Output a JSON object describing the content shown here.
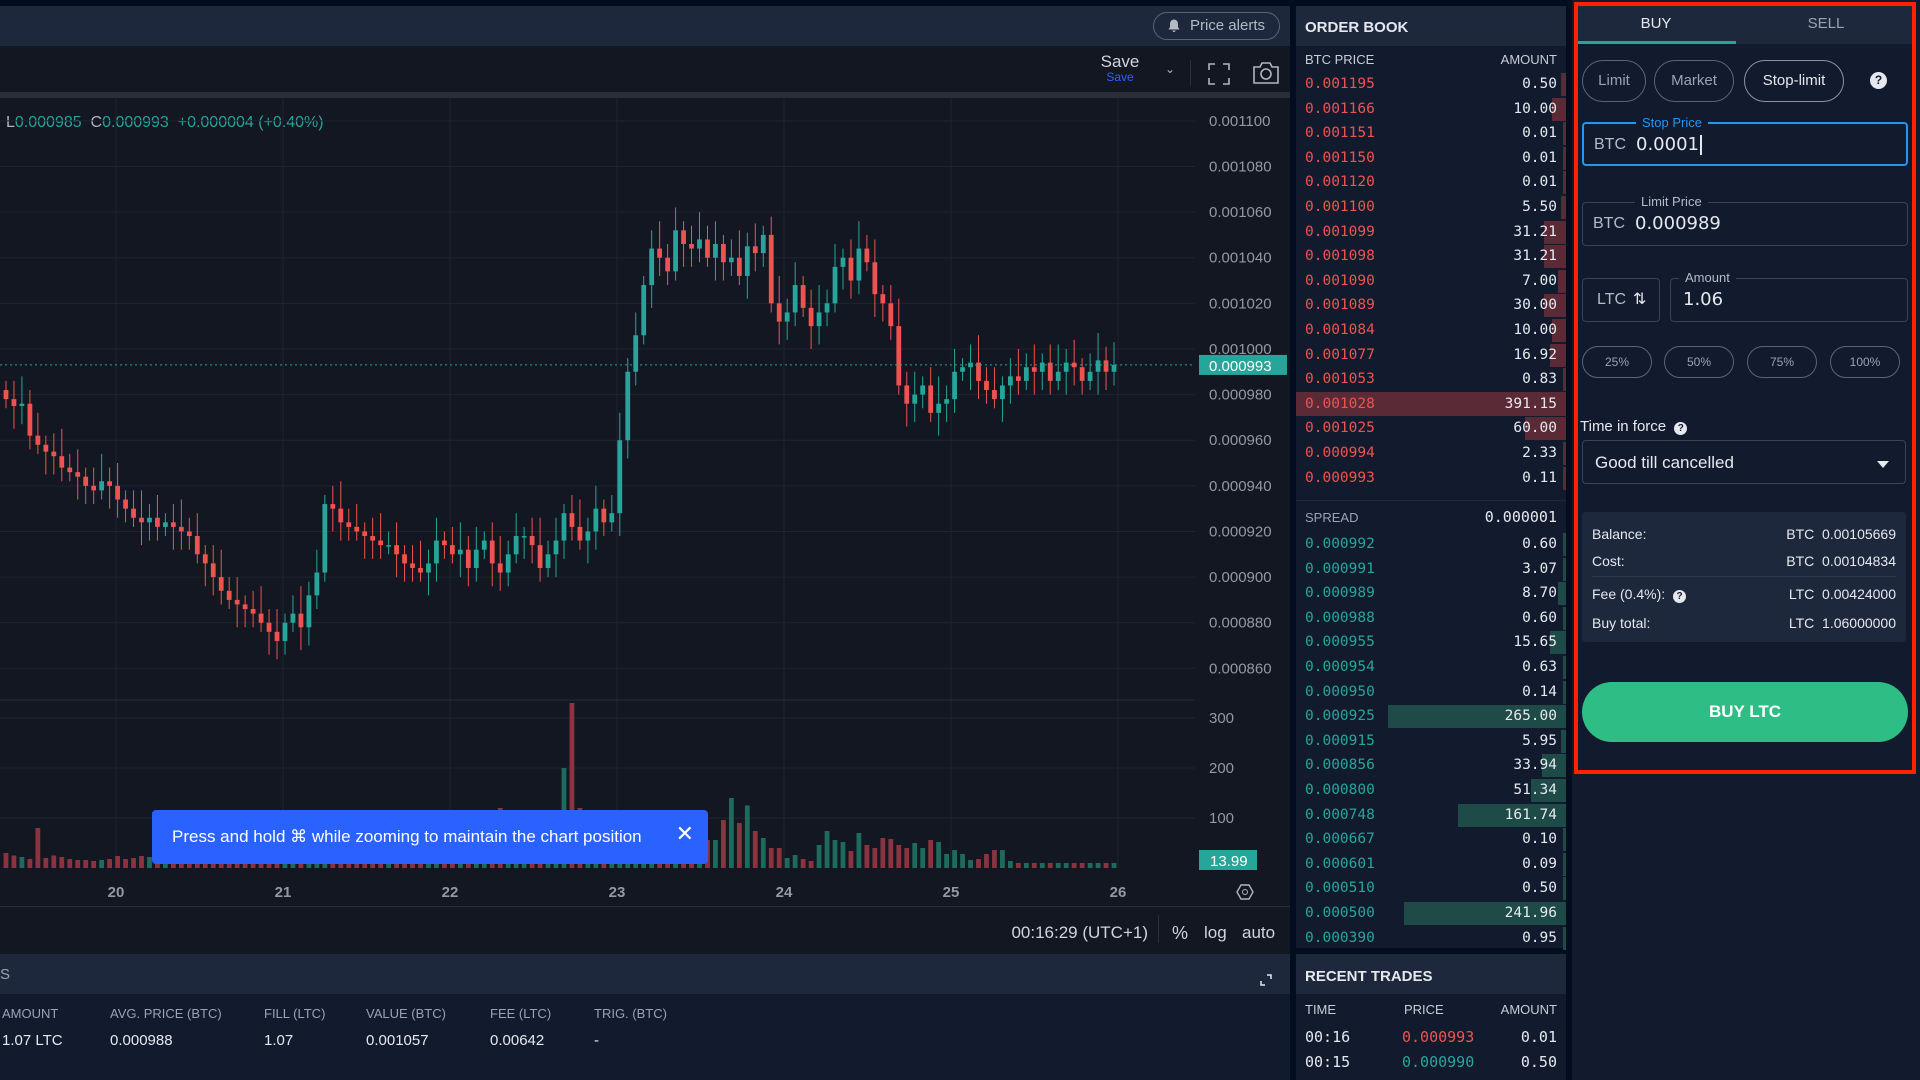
{
  "chart_header": {
    "price_alerts_label": "Price alerts",
    "save_label": "Save",
    "save_sublabel": "Save",
    "ohlc": {
      "low_label": "L",
      "low": "0.000985",
      "close_label": "C",
      "close": "0.000993",
      "change": "+0.000004 (+0.40%)"
    }
  },
  "chart_footer": {
    "clock": "00:16:29 (UTC+1)",
    "percent_label": "%",
    "log_label": "log",
    "auto_label": "auto"
  },
  "toast": {
    "message": "Press and hold ⌘ while zooming to maintain the chart position",
    "close_icon": "close-icon"
  },
  "chart_data": {
    "type": "candlestick",
    "title": "",
    "price_axis": {
      "ticks": [
        "0.001100",
        "0.001080",
        "0.001060",
        "0.001040",
        "0.001020",
        "0.001000",
        "0.000980",
        "0.000960",
        "0.000940",
        "0.000920",
        "0.000900",
        "0.000880",
        "0.000860"
      ],
      "range": [
        0.000847,
        0.00111
      ]
    },
    "last_price_label": "0.000993",
    "last_price": 0.000993,
    "volume_axis": {
      "ticks": [
        "300",
        "200",
        "100"
      ],
      "range": [
        0,
        320
      ]
    },
    "last_volume_label": "13.99",
    "date_ticks": [
      "20",
      "21",
      "22",
      "23",
      "24",
      "25",
      "26"
    ],
    "colors": {
      "up": "#26a69a",
      "down": "#ef5350"
    },
    "closes": [
      0.000978,
      0.000975,
      0.000976,
      0.000962,
      0.000958,
      0.000955,
      0.000953,
      0.000948,
      0.000946,
      0.000944,
      0.00094,
      0.000938,
      0.000942,
      0.00094,
      0.000934,
      0.00093,
      0.000926,
      0.000924,
      0.000926,
      0.000922,
      0.000924,
      0.000922,
      0.00092,
      0.000918,
      0.00091,
      0.000906,
      0.0009,
      0.000894,
      0.00089,
      0.000888,
      0.000886,
      0.000884,
      0.00088,
      0.000876,
      0.000872,
      0.00088,
      0.000884,
      0.000878,
      0.000892,
      0.000902,
      0.000932,
      0.00093,
      0.000924,
      0.000922,
      0.00092,
      0.000918,
      0.000916,
      0.000914,
      0.000914,
      0.00091,
      0.000906,
      0.000904,
      0.000902,
      0.000906,
      0.000916,
      0.000914,
      0.00091,
      0.000912,
      0.000904,
      0.000912,
      0.000916,
      0.000906,
      0.000902,
      0.00091,
      0.000918,
      0.000918,
      0.000914,
      0.000904,
      0.00091,
      0.000916,
      0.000928,
      0.000922,
      0.000916,
      0.00092,
      0.00093,
      0.000924,
      0.000928,
      0.00096,
      0.00099,
      0.001006,
      0.001028,
      0.001044,
      0.00104,
      0.001034,
      0.001052,
      0.001046,
      0.001044,
      0.001048,
      0.00104,
      0.001046,
      0.001038,
      0.00104,
      0.001032,
      0.001045,
      0.001042,
      0.00105,
      0.00102,
      0.001012,
      0.001016,
      0.001028,
      0.001018,
      0.00101,
      0.001016,
      0.00102,
      0.001036,
      0.00104,
      0.00103,
      0.001044,
      0.001038,
      0.001024,
      0.00102,
      0.00101,
      0.000984,
      0.000976,
      0.00098,
      0.000984,
      0.000972,
      0.000976,
      0.000978,
      0.00099,
      0.000992,
      0.000994,
      0.000986,
      0.000982,
      0.000978,
      0.000984,
      0.000988,
      0.000986,
      0.000992,
      0.00099,
      0.000994,
      0.000986,
      0.00099,
      0.000994,
      0.000992,
      0.000986,
      0.00099,
      0.000995,
      0.00099,
      0.000993
    ],
    "volumes": [
      30,
      25,
      22,
      18,
      80,
      20,
      25,
      22,
      18,
      16,
      16,
      14,
      16,
      18,
      24,
      18,
      20,
      24,
      22,
      35,
      30,
      25,
      40,
      22,
      30,
      26,
      30,
      38,
      28,
      50,
      30,
      28,
      24,
      20,
      22,
      26,
      24,
      28,
      22,
      20,
      26,
      24,
      20,
      22,
      30,
      24,
      28,
      26,
      22,
      22,
      24,
      28,
      30,
      22,
      26,
      30,
      24,
      22,
      20,
      26,
      50,
      55,
      120,
      60,
      58,
      100,
      60,
      40,
      36,
      100,
      200,
      330,
      120,
      60,
      70,
      90,
      50,
      40,
      36,
      90,
      36,
      80,
      56,
      60,
      62,
      40,
      32,
      34,
      56,
      56,
      96,
      140,
      90,
      125,
      74,
      60,
      40,
      40,
      20,
      26,
      18,
      14,
      46,
      74,
      56,
      52,
      34,
      70,
      46,
      40,
      60,
      58,
      46,
      40,
      50,
      40,
      56,
      52,
      28,
      36,
      28,
      16,
      18,
      28,
      36,
      36,
      14
    ]
  },
  "orders_panel": {
    "title": "S",
    "columns": [
      "AMOUNT",
      "AVG. PRICE (BTC)",
      "FILL (LTC)",
      "VALUE (BTC)",
      "FEE (LTC)",
      "TRIG. (BTC)"
    ],
    "rows": [
      [
        "1.07 LTC",
        "0.000988",
        "1.07",
        "0.001057",
        "0.00642",
        "-"
      ]
    ]
  },
  "orderbook": {
    "title": "ORDER BOOK",
    "price_header": "BTC PRICE",
    "amount_header": "AMOUNT",
    "asks": [
      {
        "price": "0.001195",
        "amount": "0.50",
        "depth": 0.02
      },
      {
        "price": "0.001166",
        "amount": "10.00",
        "depth": 0.05
      },
      {
        "price": "0.001151",
        "amount": "0.01",
        "depth": 0.01
      },
      {
        "price": "0.001150",
        "amount": "0.01",
        "depth": 0.01
      },
      {
        "price": "0.001120",
        "amount": "0.01",
        "depth": 0.01
      },
      {
        "price": "0.001100",
        "amount": "5.50",
        "depth": 0.02
      },
      {
        "price": "0.001099",
        "amount": "31.21",
        "depth": 0.08
      },
      {
        "price": "0.001098",
        "amount": "31.21",
        "depth": 0.08
      },
      {
        "price": "0.001090",
        "amount": "7.00",
        "depth": 0.03
      },
      {
        "price": "0.001089",
        "amount": "30.00",
        "depth": 0.08
      },
      {
        "price": "0.001084",
        "amount": "10.00",
        "depth": 0.05
      },
      {
        "price": "0.001077",
        "amount": "16.92",
        "depth": 0.06
      },
      {
        "price": "0.001053",
        "amount": "0.83",
        "depth": 0.01
      },
      {
        "price": "0.001028",
        "amount": "391.15",
        "depth": 1.0
      },
      {
        "price": "0.001025",
        "amount": "60.00",
        "depth": 0.15
      },
      {
        "price": "0.000994",
        "amount": "2.33",
        "depth": 0.01
      },
      {
        "price": "0.000993",
        "amount": "0.11",
        "depth": 0.01
      }
    ],
    "spread_label": "SPREAD",
    "spread_value": "0.000001",
    "bids": [
      {
        "price": "0.000992",
        "amount": "0.60",
        "depth": 0.01
      },
      {
        "price": "0.000991",
        "amount": "3.07",
        "depth": 0.01
      },
      {
        "price": "0.000989",
        "amount": "8.70",
        "depth": 0.03
      },
      {
        "price": "0.000988",
        "amount": "0.60",
        "depth": 0.01
      },
      {
        "price": "0.000955",
        "amount": "15.65",
        "depth": 0.06
      },
      {
        "price": "0.000954",
        "amount": "0.63",
        "depth": 0.01
      },
      {
        "price": "0.000950",
        "amount": "0.14",
        "depth": 0.01
      },
      {
        "price": "0.000925",
        "amount": "265.00",
        "depth": 0.66
      },
      {
        "price": "0.000915",
        "amount": "5.95",
        "depth": 0.02
      },
      {
        "price": "0.000856",
        "amount": "33.94",
        "depth": 0.09
      },
      {
        "price": "0.000800",
        "amount": "51.34",
        "depth": 0.13
      },
      {
        "price": "0.000748",
        "amount": "161.74",
        "depth": 0.4
      },
      {
        "price": "0.000667",
        "amount": "0.10",
        "depth": 0.01
      },
      {
        "price": "0.000601",
        "amount": "0.09",
        "depth": 0.01
      },
      {
        "price": "0.000510",
        "amount": "0.50",
        "depth": 0.01
      },
      {
        "price": "0.000500",
        "amount": "241.96",
        "depth": 0.6
      },
      {
        "price": "0.000390",
        "amount": "0.95",
        "depth": 0.01
      }
    ]
  },
  "recent_trades": {
    "title": "RECENT TRADES",
    "headers": [
      "TIME",
      "PRICE",
      "AMOUNT"
    ],
    "rows": [
      {
        "time": "00:16",
        "price": "0.000993",
        "amount": "0.01",
        "side": "sell"
      },
      {
        "time": "00:15",
        "price": "0.000990",
        "amount": "0.50",
        "side": "buy"
      }
    ]
  },
  "trade_form": {
    "tabs": [
      {
        "label": "BUY",
        "active": true
      },
      {
        "label": "SELL",
        "active": false
      }
    ],
    "order_types": [
      {
        "label": "Limit",
        "active": false
      },
      {
        "label": "Market",
        "active": false
      },
      {
        "label": "Stop-limit",
        "active": true
      }
    ],
    "help_glyph": "?",
    "stop_price": {
      "legend": "Stop Price",
      "currency": "BTC",
      "value": "0.0001"
    },
    "limit_price": {
      "legend": "Limit Price",
      "currency": "BTC",
      "value": "0.000989"
    },
    "amount": {
      "legend": "Amount",
      "currency": "LTC",
      "value": "1.06",
      "swap_glyph": "⇅"
    },
    "percent_buttons": [
      "25%",
      "50%",
      "75%",
      "100%"
    ],
    "time_in_force": {
      "label": "Time in force",
      "value": "Good till cancelled"
    },
    "summary": {
      "balance": {
        "label": "Balance:",
        "value": "BTC  0.00105669"
      },
      "cost": {
        "label": "Cost:",
        "value": "BTC  0.00104834"
      },
      "fee": {
        "label": "Fee (0.4%):",
        "value": "LTC  0.00424000"
      },
      "total": {
        "label": "Buy total:",
        "value": "LTC  1.06000000"
      }
    },
    "submit_label": "BUY LTC",
    "accent_color": "#2ebd85"
  }
}
